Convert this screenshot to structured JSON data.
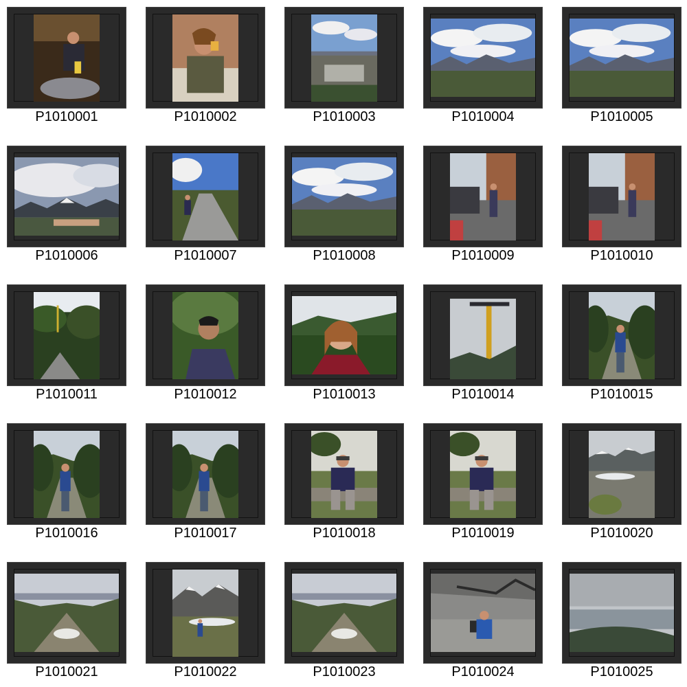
{
  "gallery": {
    "thumbnails": [
      {
        "label": "P1010001",
        "orientation": "portrait",
        "scene": "cafe"
      },
      {
        "label": "P1010002",
        "orientation": "portrait",
        "scene": "drinking"
      },
      {
        "label": "P1010003",
        "orientation": "portrait",
        "scene": "town-sky"
      },
      {
        "label": "P1010004",
        "orientation": "landscape",
        "scene": "mountains-clouds"
      },
      {
        "label": "P1010005",
        "orientation": "landscape",
        "scene": "mountains-clouds"
      },
      {
        "label": "P1010006",
        "orientation": "landscape",
        "scene": "cloudy-town"
      },
      {
        "label": "P1010007",
        "orientation": "portrait",
        "scene": "road-person"
      },
      {
        "label": "P1010008",
        "orientation": "landscape",
        "scene": "mountains-clouds"
      },
      {
        "label": "P1010009",
        "orientation": "portrait",
        "scene": "street"
      },
      {
        "label": "P1010010",
        "orientation": "portrait",
        "scene": "street"
      },
      {
        "label": "P1010011",
        "orientation": "portrait",
        "scene": "forest-stream"
      },
      {
        "label": "P1010012",
        "orientation": "portrait",
        "scene": "portrait-forest"
      },
      {
        "label": "P1010013",
        "orientation": "landscape",
        "scene": "portrait-woman"
      },
      {
        "label": "P1010014",
        "orientation": "portrait",
        "scene": "chairlift"
      },
      {
        "label": "P1010015",
        "orientation": "portrait",
        "scene": "trail-person"
      },
      {
        "label": "P1010016",
        "orientation": "portrait",
        "scene": "trail-person"
      },
      {
        "label": "P1010017",
        "orientation": "portrait",
        "scene": "trail-person"
      },
      {
        "label": "P1010018",
        "orientation": "portrait",
        "scene": "sitting-person"
      },
      {
        "label": "P1010019",
        "orientation": "portrait",
        "scene": "sitting-person"
      },
      {
        "label": "P1010020",
        "orientation": "portrait",
        "scene": "glacier"
      },
      {
        "label": "P1010021",
        "orientation": "landscape",
        "scene": "valley"
      },
      {
        "label": "P1010022",
        "orientation": "portrait",
        "scene": "glacier-person"
      },
      {
        "label": "P1010023",
        "orientation": "landscape",
        "scene": "valley"
      },
      {
        "label": "P1010024",
        "orientation": "landscape",
        "scene": "rocks-person"
      },
      {
        "label": "P1010025",
        "orientation": "landscape",
        "scene": "overcast-bay"
      }
    ]
  }
}
